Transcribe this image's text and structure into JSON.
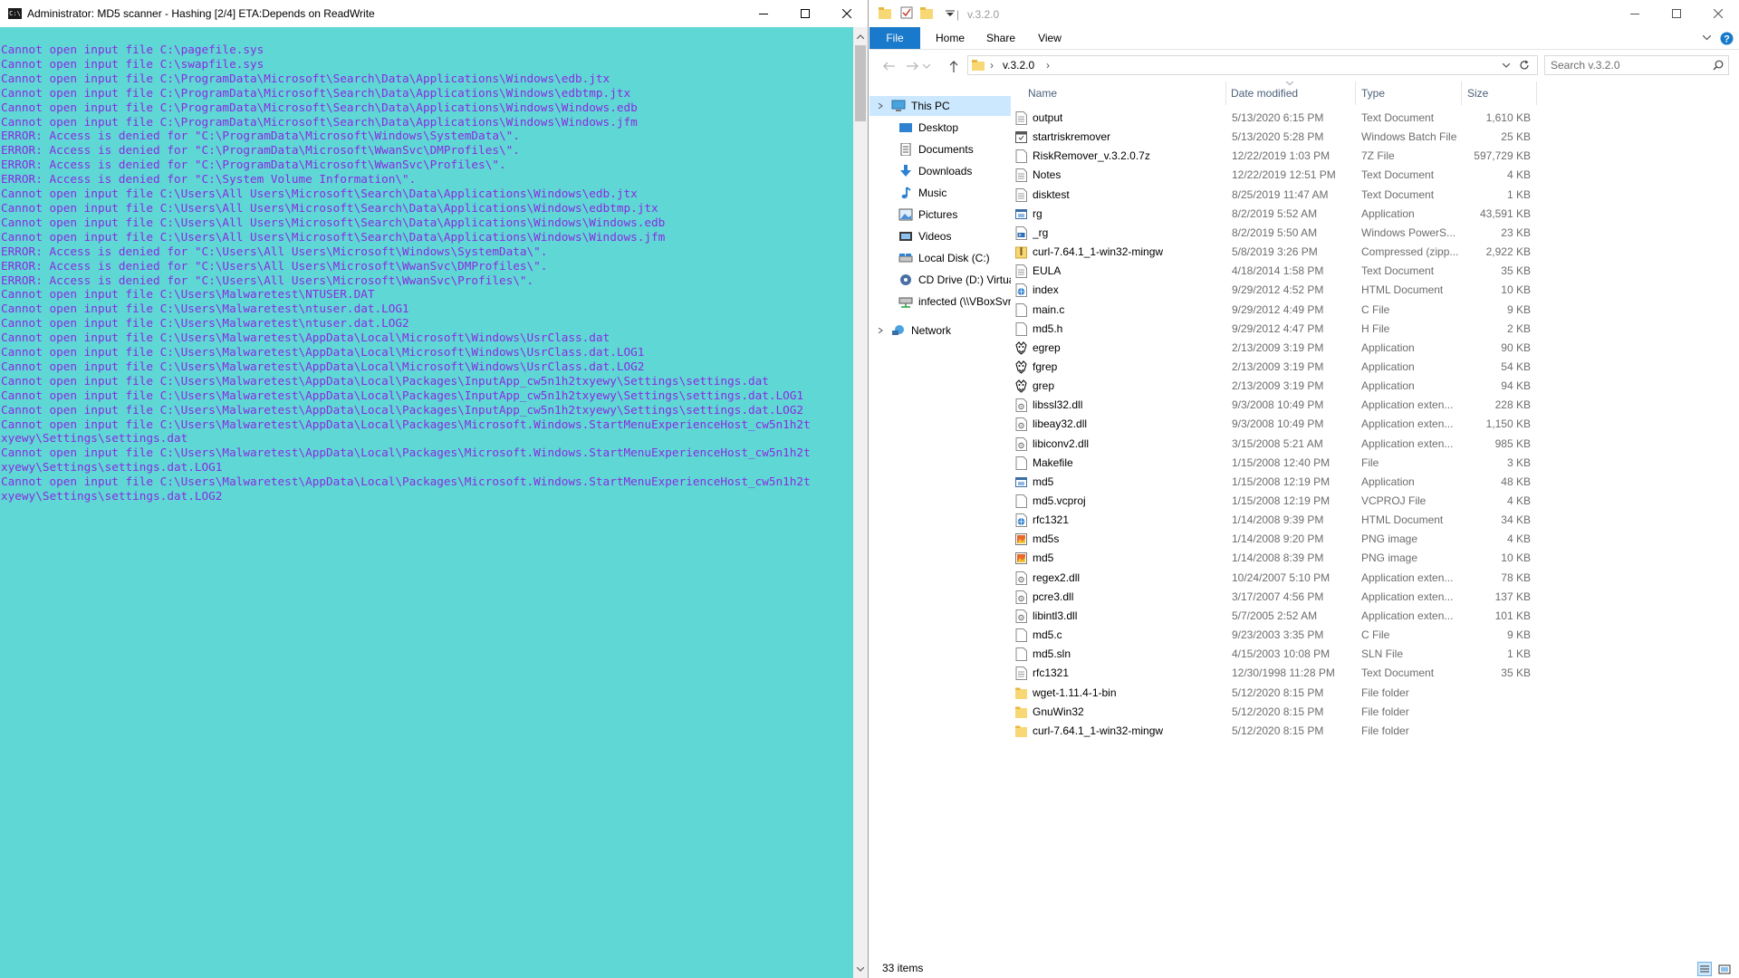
{
  "console": {
    "title": "Administrator:  MD5 scanner - Hashing [2/4] ETA:Depends on ReadWrite",
    "icon": "console-icon",
    "colors": {
      "background": "#5fd7d5",
      "text": "#8a2be2"
    },
    "lines": [
      "Cannot open input file C:\\pagefile.sys",
      "Cannot open input file C:\\swapfile.sys",
      "Cannot open input file C:\\ProgramData\\Microsoft\\Search\\Data\\Applications\\Windows\\edb.jtx",
      "Cannot open input file C:\\ProgramData\\Microsoft\\Search\\Data\\Applications\\Windows\\edbtmp.jtx",
      "Cannot open input file C:\\ProgramData\\Microsoft\\Search\\Data\\Applications\\Windows\\Windows.edb",
      "Cannot open input file C:\\ProgramData\\Microsoft\\Search\\Data\\Applications\\Windows\\Windows.jfm",
      "ERROR: Access is denied for \"C:\\ProgramData\\Microsoft\\Windows\\SystemData\\\".",
      "ERROR: Access is denied for \"C:\\ProgramData\\Microsoft\\WwanSvc\\DMProfiles\\\".",
      "ERROR: Access is denied for \"C:\\ProgramData\\Microsoft\\WwanSvc\\Profiles\\\".",
      "ERROR: Access is denied for \"C:\\System Volume Information\\\".",
      "Cannot open input file C:\\Users\\All Users\\Microsoft\\Search\\Data\\Applications\\Windows\\edb.jtx",
      "Cannot open input file C:\\Users\\All Users\\Microsoft\\Search\\Data\\Applications\\Windows\\edbtmp.jtx",
      "Cannot open input file C:\\Users\\All Users\\Microsoft\\Search\\Data\\Applications\\Windows\\Windows.edb",
      "Cannot open input file C:\\Users\\All Users\\Microsoft\\Search\\Data\\Applications\\Windows\\Windows.jfm",
      "ERROR: Access is denied for \"C:\\Users\\All Users\\Microsoft\\Windows\\SystemData\\\".",
      "ERROR: Access is denied for \"C:\\Users\\All Users\\Microsoft\\WwanSvc\\DMProfiles\\\".",
      "ERROR: Access is denied for \"C:\\Users\\All Users\\Microsoft\\WwanSvc\\Profiles\\\".",
      "Cannot open input file C:\\Users\\Malwaretest\\NTUSER.DAT",
      "Cannot open input file C:\\Users\\Malwaretest\\ntuser.dat.LOG1",
      "Cannot open input file C:\\Users\\Malwaretest\\ntuser.dat.LOG2",
      "Cannot open input file C:\\Users\\Malwaretest\\AppData\\Local\\Microsoft\\Windows\\UsrClass.dat",
      "Cannot open input file C:\\Users\\Malwaretest\\AppData\\Local\\Microsoft\\Windows\\UsrClass.dat.LOG1",
      "Cannot open input file C:\\Users\\Malwaretest\\AppData\\Local\\Microsoft\\Windows\\UsrClass.dat.LOG2",
      "Cannot open input file C:\\Users\\Malwaretest\\AppData\\Local\\Packages\\InputApp_cw5n1h2txyewy\\Settings\\settings.dat",
      "Cannot open input file C:\\Users\\Malwaretest\\AppData\\Local\\Packages\\InputApp_cw5n1h2txyewy\\Settings\\settings.dat.LOG1",
      "Cannot open input file C:\\Users\\Malwaretest\\AppData\\Local\\Packages\\InputApp_cw5n1h2txyewy\\Settings\\settings.dat.LOG2",
      "Cannot open input file C:\\Users\\Malwaretest\\AppData\\Local\\Packages\\Microsoft.Windows.StartMenuExperienceHost_cw5n1h2t",
      "xyewy\\Settings\\settings.dat",
      "Cannot open input file C:\\Users\\Malwaretest\\AppData\\Local\\Packages\\Microsoft.Windows.StartMenuExperienceHost_cw5n1h2t",
      "xyewy\\Settings\\settings.dat.LOG1",
      "Cannot open input file C:\\Users\\Malwaretest\\AppData\\Local\\Packages\\Microsoft.Windows.StartMenuExperienceHost_cw5n1h2t",
      "xyewy\\Settings\\settings.dat.LOG2"
    ]
  },
  "explorer": {
    "title": "v.3.2.0",
    "ribbon_tabs": [
      "File",
      "Home",
      "Share",
      "View"
    ],
    "accent": "#1979ca",
    "address": {
      "path": "v.3.2.0",
      "separator": "›"
    },
    "search": {
      "placeholder": "Search v.3.2.0"
    },
    "nav": [
      {
        "label": "This PC",
        "icon": "pc-icon",
        "selected": true
      },
      {
        "label": "Desktop",
        "icon": "desktop-icon"
      },
      {
        "label": "Documents",
        "icon": "documents-icon"
      },
      {
        "label": "Downloads",
        "icon": "downloads-icon"
      },
      {
        "label": "Music",
        "icon": "music-icon"
      },
      {
        "label": "Pictures",
        "icon": "pictures-icon"
      },
      {
        "label": "Videos",
        "icon": "videos-icon"
      },
      {
        "label": "Local Disk (C:)",
        "icon": "drive-icon"
      },
      {
        "label": "CD Drive (D:) Virtua",
        "icon": "cd-drive-icon"
      },
      {
        "label": "infected (\\\\VBoxSvr",
        "icon": "network-drive-icon"
      },
      {
        "label": "Network",
        "icon": "network-icon"
      }
    ],
    "columns": [
      "Name",
      "Date modified",
      "Type",
      "Size"
    ],
    "files": [
      {
        "name": "output",
        "date": "5/13/2020 6:15 PM",
        "type": "Text Document",
        "size": "1,610 KB",
        "icon": "text-file-icon"
      },
      {
        "name": "startriskremover",
        "date": "5/13/2020 5:28 PM",
        "type": "Windows Batch File",
        "size": "25 KB",
        "icon": "batch-file-icon"
      },
      {
        "name": "RiskRemover_v.3.2.0.7z",
        "date": "12/22/2019 1:03 PM",
        "type": "7Z File",
        "size": "597,729 KB",
        "icon": "generic-file-icon"
      },
      {
        "name": "Notes",
        "date": "12/22/2019 12:51 PM",
        "type": "Text Document",
        "size": "4 KB",
        "icon": "text-file-icon"
      },
      {
        "name": "disktest",
        "date": "8/25/2019 11:47 AM",
        "type": "Text Document",
        "size": "1 KB",
        "icon": "text-file-icon"
      },
      {
        "name": "rg",
        "date": "8/2/2019 5:52 AM",
        "type": "Application",
        "size": "43,591 KB",
        "icon": "application-icon"
      },
      {
        "name": "_rg",
        "date": "8/2/2019 5:50 AM",
        "type": "Windows PowerS...",
        "size": "23 KB",
        "icon": "powershell-file-icon"
      },
      {
        "name": "curl-7.64.1_1-win32-mingw",
        "date": "5/8/2019 3:26 PM",
        "type": "Compressed (zipp...",
        "size": "2,922 KB",
        "icon": "zip-folder-icon"
      },
      {
        "name": "EULA",
        "date": "4/18/2014 1:58 PM",
        "type": "Text Document",
        "size": "35 KB",
        "icon": "text-file-icon"
      },
      {
        "name": "index",
        "date": "9/29/2012 4:52 PM",
        "type": "HTML Document",
        "size": "10 KB",
        "icon": "html-file-icon"
      },
      {
        "name": "main.c",
        "date": "9/29/2012 4:49 PM",
        "type": "C File",
        "size": "9 KB",
        "icon": "generic-file-icon"
      },
      {
        "name": "md5.h",
        "date": "9/29/2012 4:47 PM",
        "type": "H File",
        "size": "2 KB",
        "icon": "generic-file-icon"
      },
      {
        "name": "egrep",
        "date": "2/13/2009 3:19 PM",
        "type": "Application",
        "size": "90 KB",
        "icon": "gnu-app-icon"
      },
      {
        "name": "fgrep",
        "date": "2/13/2009 3:19 PM",
        "type": "Application",
        "size": "54 KB",
        "icon": "gnu-app-icon"
      },
      {
        "name": "grep",
        "date": "2/13/2009 3:19 PM",
        "type": "Application",
        "size": "94 KB",
        "icon": "gnu-app-icon"
      },
      {
        "name": "libssl32.dll",
        "date": "9/3/2008 10:49 PM",
        "type": "Application exten...",
        "size": "228 KB",
        "icon": "dll-file-icon"
      },
      {
        "name": "libeay32.dll",
        "date": "9/3/2008 10:49 PM",
        "type": "Application exten...",
        "size": "1,150 KB",
        "icon": "dll-file-icon"
      },
      {
        "name": "libiconv2.dll",
        "date": "3/15/2008 5:21 AM",
        "type": "Application exten...",
        "size": "985 KB",
        "icon": "dll-file-icon"
      },
      {
        "name": "Makefile",
        "date": "1/15/2008 12:40 PM",
        "type": "File",
        "size": "3 KB",
        "icon": "generic-file-icon"
      },
      {
        "name": "md5",
        "date": "1/15/2008 12:19 PM",
        "type": "Application",
        "size": "48 KB",
        "icon": "application-icon"
      },
      {
        "name": "md5.vcproj",
        "date": "1/15/2008 12:19 PM",
        "type": "VCPROJ File",
        "size": "4 KB",
        "icon": "generic-file-icon"
      },
      {
        "name": "rfc1321",
        "date": "1/14/2008 9:39 PM",
        "type": "HTML Document",
        "size": "34 KB",
        "icon": "html-file-icon"
      },
      {
        "name": "md5s",
        "date": "1/14/2008 9:20 PM",
        "type": "PNG image",
        "size": "4 KB",
        "icon": "image-file-icon"
      },
      {
        "name": "md5",
        "date": "1/14/2008 8:39 PM",
        "type": "PNG image",
        "size": "10 KB",
        "icon": "image-file-icon"
      },
      {
        "name": "regex2.dll",
        "date": "10/24/2007 5:10 PM",
        "type": "Application exten...",
        "size": "78 KB",
        "icon": "dll-file-icon"
      },
      {
        "name": "pcre3.dll",
        "date": "3/17/2007 4:56 PM",
        "type": "Application exten...",
        "size": "137 KB",
        "icon": "dll-file-icon"
      },
      {
        "name": "libintl3.dll",
        "date": "5/7/2005 2:52 AM",
        "type": "Application exten...",
        "size": "101 KB",
        "icon": "dll-file-icon"
      },
      {
        "name": "md5.c",
        "date": "9/23/2003 3:35 PM",
        "type": "C File",
        "size": "9 KB",
        "icon": "generic-file-icon"
      },
      {
        "name": "md5.sln",
        "date": "4/15/2003 10:08 PM",
        "type": "SLN File",
        "size": "1 KB",
        "icon": "generic-file-icon"
      },
      {
        "name": "rfc1321",
        "date": "12/30/1998 11:28 PM",
        "type": "Text Document",
        "size": "35 KB",
        "icon": "text-file-icon"
      },
      {
        "name": "wget-1.11.4-1-bin",
        "date": "5/12/2020 8:15 PM",
        "type": "File folder",
        "size": "",
        "icon": "folder-icon"
      },
      {
        "name": "GnuWin32",
        "date": "5/12/2020 8:15 PM",
        "type": "File folder",
        "size": "",
        "icon": "folder-icon"
      },
      {
        "name": "curl-7.64.1_1-win32-mingw",
        "date": "5/12/2020 8:15 PM",
        "type": "File folder",
        "size": "",
        "icon": "folder-icon"
      }
    ],
    "status": "33 items"
  }
}
